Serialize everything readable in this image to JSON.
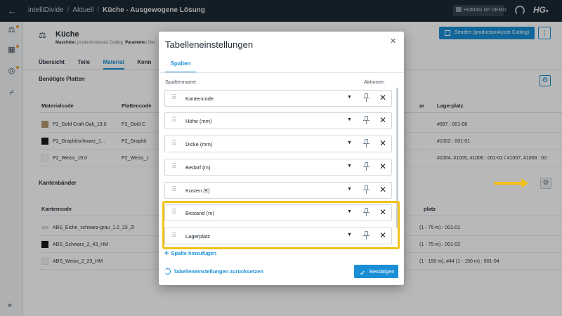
{
  "app": {
    "name": "intelliDivide",
    "breadcrumbs": [
      "intelliDivide",
      "Aktuell",
      "Küche - Ausgewogene Lösung"
    ],
    "badge": "HOMAG DF DEMO",
    "logo": "HG"
  },
  "page": {
    "title": "Küche",
    "machine_label": "Maschine:",
    "machine_value": "productionAssist Cutting",
    "parameter_label": "Parameter:",
    "parameter_value": "Der",
    "send_button": "Senden (productionAssist Cutting)",
    "more_button": "⋮",
    "tabs": [
      "Übersicht",
      "Teile",
      "Material",
      "Kenn"
    ],
    "active_tab": "Material"
  },
  "boards": {
    "section_title": "Benötigte Platten",
    "headers": [
      "Materialcode",
      "Plattencode",
      "Lagerplatz"
    ],
    "header_partial": "ar",
    "rows": [
      {
        "code": "P2_Gold Craft Oak_19.0",
        "board": "P2_Gold C",
        "lager": "#997 : 001-06",
        "color": "#b49a72"
      },
      {
        "code": "P2_Graphitschwarz_1...",
        "board": "P2_Graphit",
        "lager": "#1002 : 001-01",
        "color": "#1a1a1a"
      },
      {
        "code": "P2_Weiss_19.0",
        "board": "P2_Weiss_1",
        "lager": "#1004, #1005, #1006 : 001-02 / #1007, #1008 : 00",
        "color": "#f5f5f2"
      }
    ]
  },
  "edges": {
    "section_title": "Kantenbänder",
    "headers": [
      "Kantencode",
      "platz"
    ],
    "rows": [
      {
        "code": "ABS_Eiche_schwarz-grau_1.2_23_ZI",
        "lager": "(1 - 75 m) : 001-01",
        "color": "#d8d8d6"
      },
      {
        "code": "ABS_Schwarz_2_43_HM",
        "lager": "(1 - 75 m) : 001-02",
        "color": "#1a1a1a"
      },
      {
        "code": "ABS_Weiss_2_23_HM",
        "lager": "(1 - 150 m), #44 (1 - 150 m) : 001-04",
        "color": "#f1f1ef"
      }
    ]
  },
  "modal": {
    "title": "Tabelleneinstellungen",
    "tab": "Spalten",
    "col_name_header": "Spaltenname",
    "col_actions_header": "Aktionen",
    "columns": [
      "Kantencode",
      "Höhe (mm)",
      "Dicke (mm)",
      "Bedarf (m)",
      "Kosten (€)",
      "Bestand (m)",
      "Lagerplatz"
    ],
    "add_column": "Spalte hinzufügen",
    "reset": "Tabelleneinstellungen zurücksetzen",
    "confirm": "Bestätigen"
  },
  "colors": {
    "accent": "#1a8fd6",
    "topbar": "#1e2d3b",
    "highlight": "#f2c21b"
  }
}
